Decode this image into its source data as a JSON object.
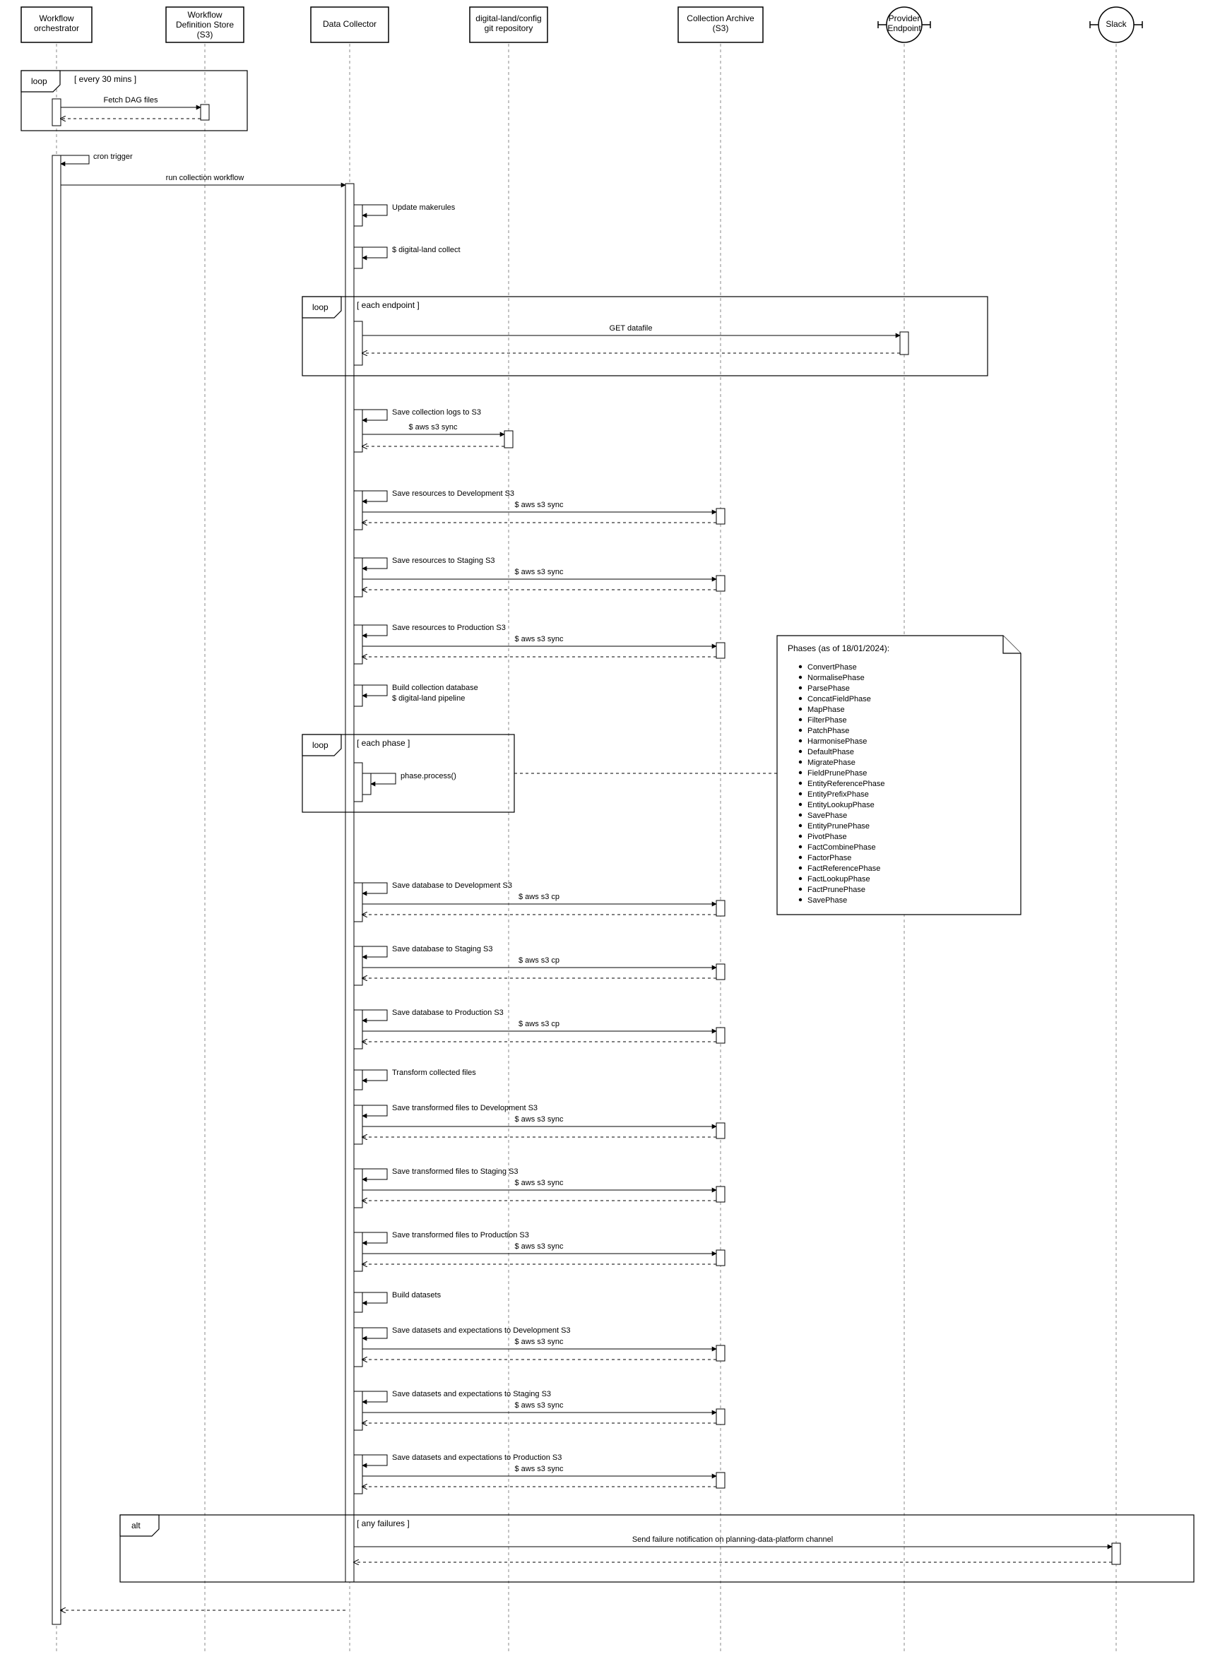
{
  "actors": {
    "orchestrator": "Workflow\norchestrator",
    "defstore": "Workflow\nDefinition Store\n(S3)",
    "collector": "Data Collector",
    "gitrepo": "digital-land/config\ngit repository",
    "archive": "Collection Archive\n(S3)",
    "provider": "Provider\nEndpoint",
    "slack": "Slack"
  },
  "frames": {
    "loop30": {
      "tag": "loop",
      "guard": "[ every 30 mins ]"
    },
    "loopEndpoint": {
      "tag": "loop",
      "guard": "[ each endpoint ]"
    },
    "loopPhase": {
      "tag": "loop",
      "guard": "[ each phase ]"
    },
    "alt": {
      "tag": "alt",
      "guard": "[ any failures ]"
    }
  },
  "messages": {
    "fetchDag": "Fetch DAG files",
    "cronTrigger": "cron trigger",
    "runWorkflow": "run collection workflow",
    "updateMakerules": "Update makerules",
    "dlCollect": "$ digital-land collect",
    "getDatafile": "GET datafile",
    "saveLogs": "Save collection logs to S3",
    "awsSync": "$ aws s3 sync",
    "awsCp": "$ aws s3 cp",
    "saveResDev": "Save resources to Development S3",
    "saveResStg": "Save resources to Staging S3",
    "saveResProd": "Save resources to Production S3",
    "buildCollDb": "Build collection database",
    "dlPipeline": "$ digital-land pipeline",
    "phaseProcess": "phase.process()",
    "saveDbDev": "Save database to Development S3",
    "saveDbStg": "Save database to Staging S3",
    "saveDbProd": "Save database to Production S3",
    "transform": "Transform collected files",
    "saveTransDev": "Save transformed files to Development S3",
    "saveTransStg": "Save transformed files to Staging S3",
    "saveTransProd": "Save transformed files to Production S3",
    "buildDatasets": "Build datasets",
    "saveDataDev": "Save datasets and expectations to Development S3",
    "saveDataStg": "Save datasets and expectations to Staging S3",
    "saveDataProd": "Save datasets and expectations to Production S3",
    "sendFailure": "Send failure notification on planning-data-platform channel"
  },
  "note": {
    "title": "Phases (as of 18/01/2024):",
    "items": [
      "ConvertPhase",
      "NormalisePhase",
      "ParsePhase",
      "ConcatFieldPhase",
      "MapPhase",
      "FilterPhase",
      "PatchPhase",
      "HarmonisePhase",
      "DefaultPhase",
      "MigratePhase",
      "FieldPrunePhase",
      "EntityReferencePhase",
      "EntityPrefixPhase",
      "EntityLookupPhase",
      "SavePhase",
      "EntityPrunePhase",
      "PivotPhase",
      "FactCombinePhase",
      "FactorPhase",
      "FactReferencePhase",
      "FactLookupPhase",
      "FactPrunePhase",
      "SavePhase"
    ]
  }
}
